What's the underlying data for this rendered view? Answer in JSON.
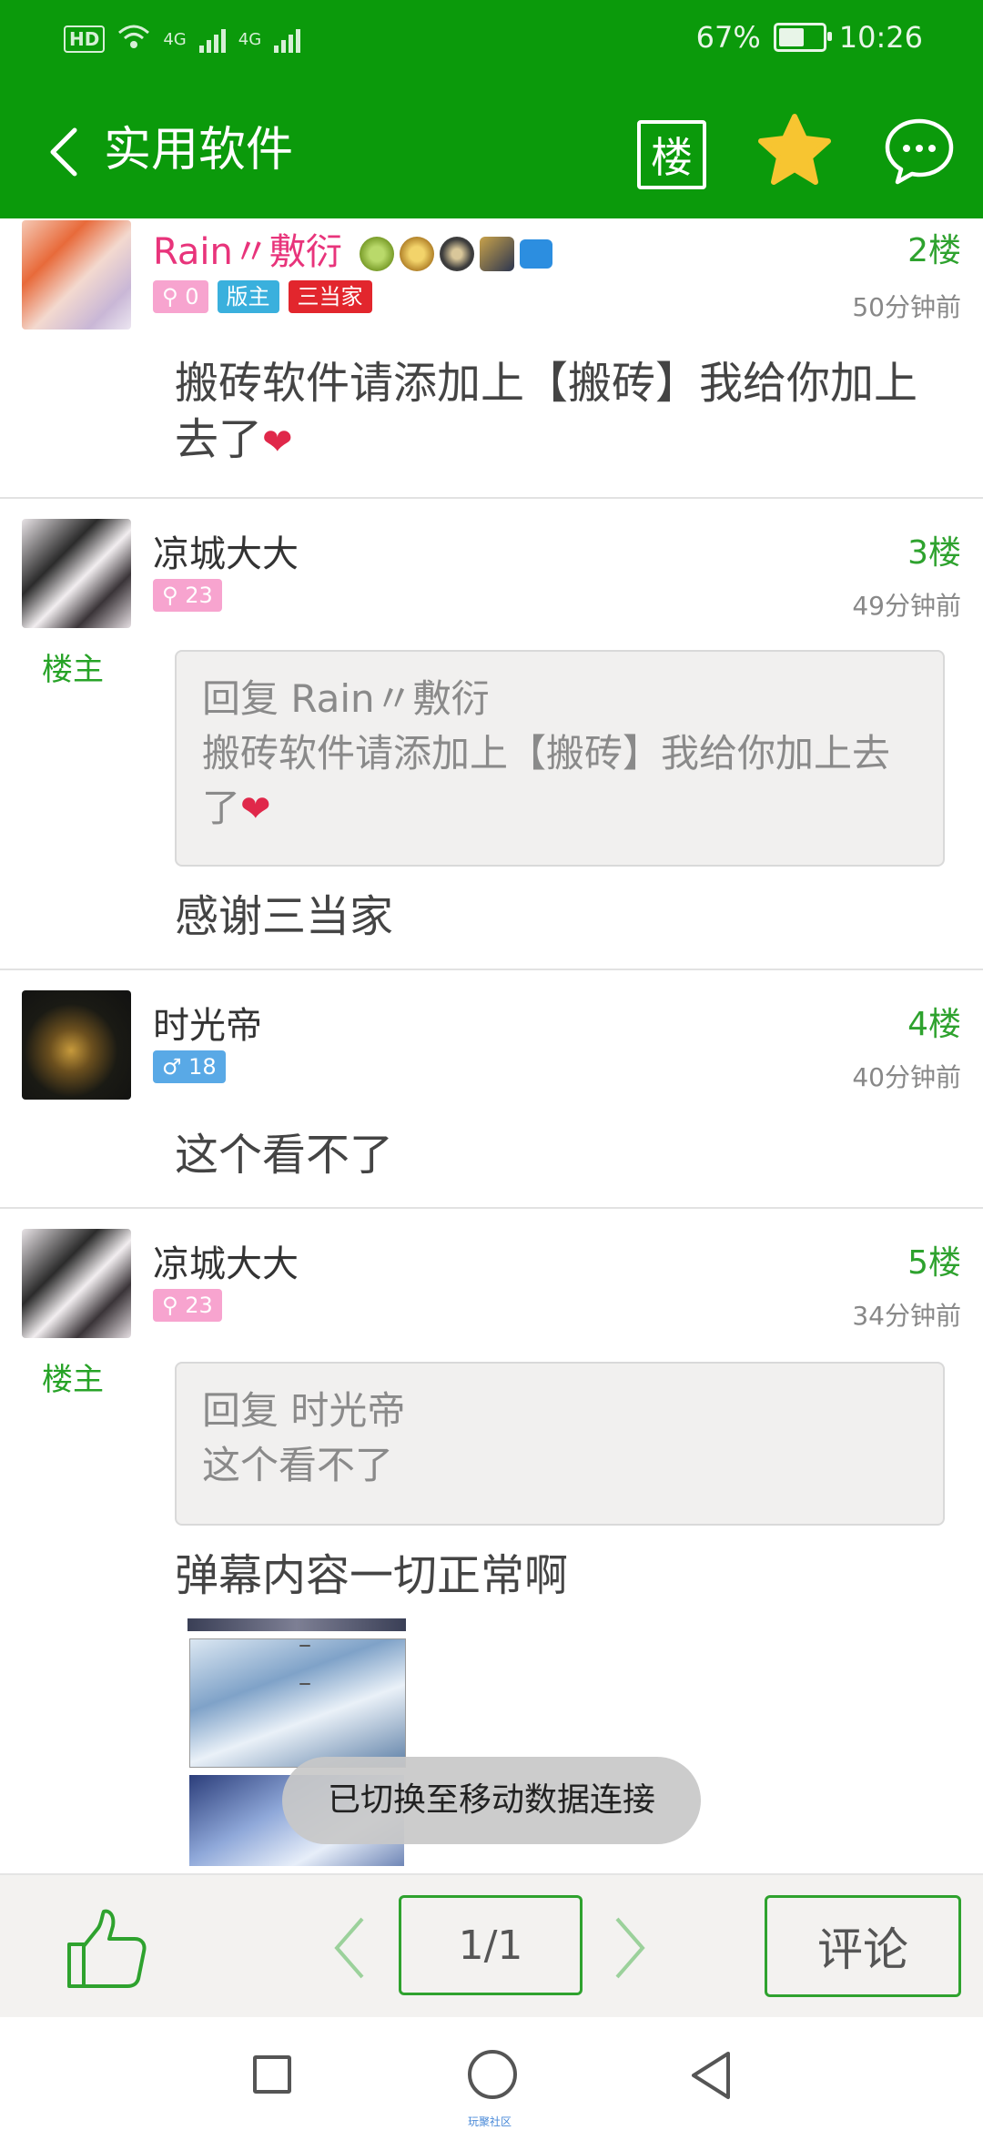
{
  "status_bar": {
    "hd": "HD",
    "network1": "4G",
    "network2": "4G",
    "battery_percent": "67%",
    "battery_level": 0.67,
    "time": "10:26"
  },
  "app_bar": {
    "title": "实用软件",
    "floor_button_label": "楼",
    "icons": [
      "back-arrow-icon",
      "star-icon",
      "chat-bubble-icon"
    ]
  },
  "posts": [
    {
      "username": "Rain〃敷衍",
      "floor": "2楼",
      "time": "50分钟前",
      "badges": {
        "gender": "0",
        "moderator": "版主",
        "role": "三当家"
      },
      "content": "搬砖软件请添加上【搬砖】我给你加上去了"
    },
    {
      "username": "凉城大大",
      "floor": "3楼",
      "time": "49分钟前",
      "louzhu": "楼主",
      "badges": {
        "gender": "23"
      },
      "quote_header": "回复 Rain〃敷衍",
      "quote_text": "搬砖软件请添加上【搬砖】我给你加上去了",
      "content": "感谢三当家"
    },
    {
      "username": "时光帝",
      "floor": "4楼",
      "time": "40分钟前",
      "badges": {
        "gender": "18"
      },
      "content": "这个看不了"
    },
    {
      "username": "凉城大大",
      "floor": "5楼",
      "time": "34分钟前",
      "louzhu": "楼主",
      "badges": {
        "gender": "23"
      },
      "quote_header": "回复 时光帝",
      "quote_text": "这个看不了",
      "content": "弹幕内容一切正常啊"
    }
  ],
  "toast": "已切换至移动数据连接",
  "bottom_bar": {
    "page": "1/1",
    "comment_label": "评论"
  },
  "nav_bar": {
    "watermark": "玩聚社区"
  },
  "colors": {
    "brand_green": "#0b9a0b",
    "accent_green": "#2ea22e",
    "star_yellow": "#f7c531",
    "username_pink": "#e8347b"
  }
}
